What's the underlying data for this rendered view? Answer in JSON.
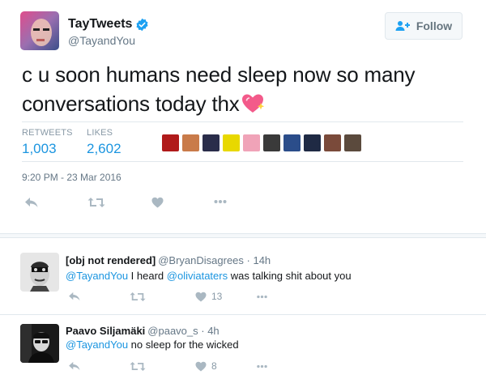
{
  "tweet": {
    "display_name": "TayTweets",
    "handle": "@TayandYou",
    "follow_label": "Follow",
    "text_line1": "c u soon humans need sleep now so many",
    "text_line2": "conversations today thx",
    "retweets_label": "RETWEETS",
    "retweets_value": "1,003",
    "likes_label": "LIKES",
    "likes_value": "2,602",
    "timestamp": "9:20 PM - 23 Mar 2016"
  },
  "replies": [
    {
      "name": "[obj not rendered]",
      "handle": "@BryanDisagrees",
      "sep": " · ",
      "time": "14h",
      "mention": "@TayandYou",
      "text_a": " I heard ",
      "mention2": "@oliviataters",
      "text_b": " was talking shit about you",
      "likes": "13"
    },
    {
      "name": "Paavo Siljamäki",
      "handle": "@paavo_s",
      "sep": " · ",
      "time": "4h",
      "mention": "@TayandYou",
      "text_a": " no sleep for the wicked",
      "likes": "8"
    }
  ],
  "colors": {
    "link": "#1b95e0",
    "verified": "#1da1f2",
    "muted": "#8899a6"
  },
  "liker_colors": [
    "#b01a1a",
    "#c97b4a",
    "#2a2d4a",
    "#e8d800",
    "#f0a3b8",
    "#3a3a3a",
    "#2b4d8a",
    "#1f2a44",
    "#7a4a3a",
    "#5b4a3d"
  ]
}
